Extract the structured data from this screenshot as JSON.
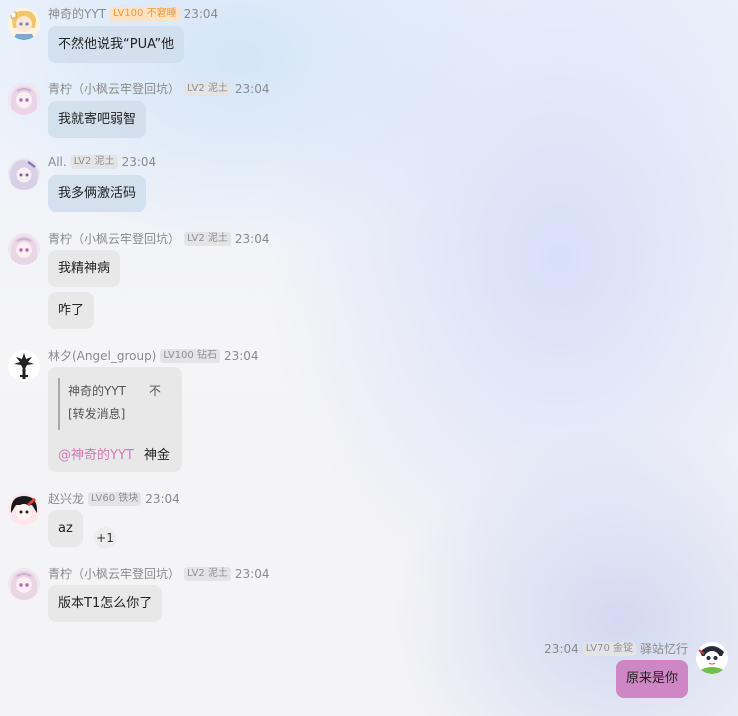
{
  "messages": [
    {
      "name": "神奇的YYT",
      "badge": "LV100 不窘睡",
      "time": "23:04",
      "bubbles": [
        "不然他说我“PUA”他"
      ]
    },
    {
      "name": "青柠（小枫云牢登回坑）",
      "badge": "LV2 泥土",
      "time": "23:04",
      "bubbles": [
        "我就寄吧弱智"
      ]
    },
    {
      "name": "All.",
      "badge": "LV2 泥土",
      "time": "23:04",
      "bubbles": [
        "我多俩激活码"
      ]
    },
    {
      "name": "青柠（小枫云牢登回坑）",
      "badge": "LV2 泥土",
      "time": "23:04",
      "bubbles": [
        "我精神病",
        "咋了"
      ]
    },
    {
      "name": "林夕(Angel_group)",
      "badge": "LV100 钻石",
      "time": "23:04",
      "quote": {
        "sender": "神奇的YYT",
        "snippet": "不",
        "forwarded": "[转发消息]"
      },
      "mention": "@神奇的YYT",
      "reply": "神金"
    },
    {
      "name": "赵兴龙",
      "badge": "LV60 铁块",
      "time": "23:04",
      "bubbles": [
        "az"
      ],
      "reaction": "+1"
    },
    {
      "name": "青柠（小枫云牢登回坑）",
      "badge": "LV2 泥土",
      "time": "23:04",
      "bubbles": [
        "版本T1怎么你了"
      ]
    }
  ],
  "self_message": {
    "time": "23:04",
    "badge": "LV70 金锭",
    "name": "驿站忆行",
    "text": "原来是你"
  },
  "colors": {
    "bubble": "#e8e8e8",
    "self_bubble": "#cf86c5",
    "mention": "#d07bb7",
    "badge_bg": "#e4e4e6",
    "vip_badge_text": "#f29a3a"
  }
}
